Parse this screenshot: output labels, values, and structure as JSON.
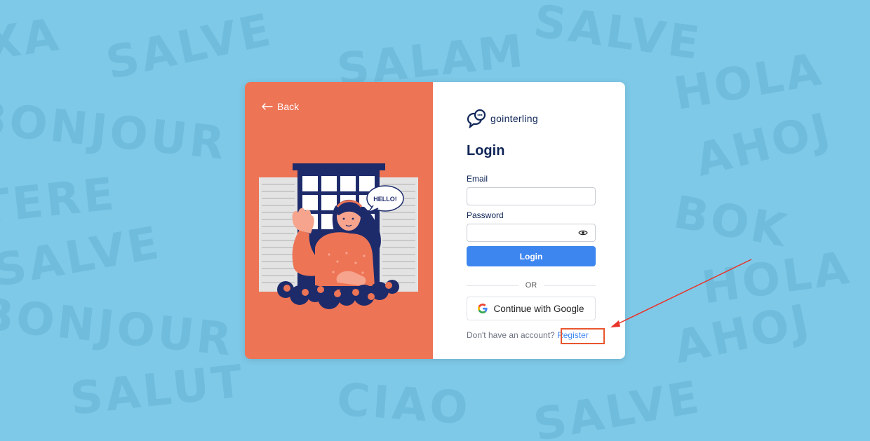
{
  "background_words": [
    "SALVE",
    "BOK",
    "SALAM",
    "HOLA",
    "BONJOUR",
    "CIAO",
    "AHOJ",
    "TERE",
    "SALUT",
    "XA"
  ],
  "nav": {
    "back_label": "Back"
  },
  "illustration": {
    "speech_bubble": "HELLO!"
  },
  "brand": {
    "name": "gointerling",
    "accent_color": "#ed7455",
    "primary_color": "#3d86f0",
    "navy": "#0f2557"
  },
  "form": {
    "title": "Login",
    "email_label": "Email",
    "email_value": "",
    "password_label": "Password",
    "password_value": "",
    "login_button": "Login",
    "or_label": "OR",
    "google_button": "Continue with Google",
    "no_account_text": "Don't have an account?",
    "register_link": "Register"
  },
  "icons": {
    "back": "arrow-left-icon",
    "eye": "eye-icon",
    "google": "google-g-icon",
    "logo": "chat-bubble-logo-icon"
  },
  "annotation": {
    "highlight_color": "#e8562f",
    "arrow_color": "#e8342a"
  }
}
